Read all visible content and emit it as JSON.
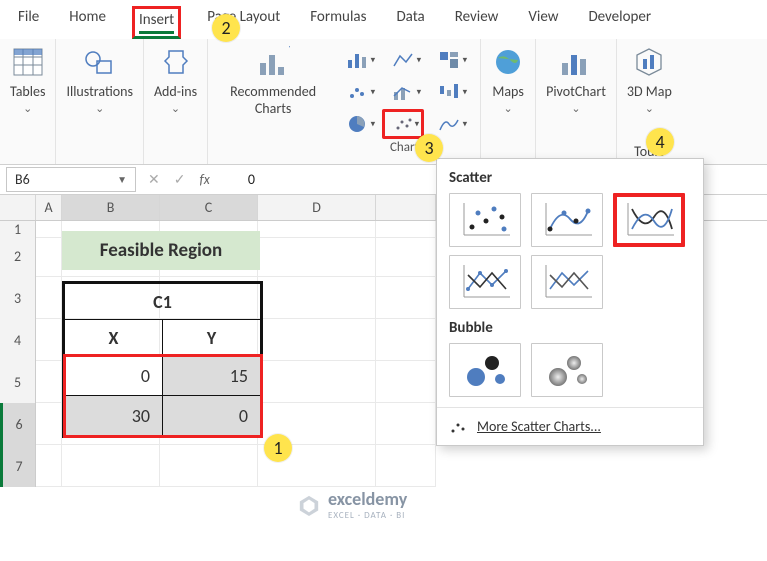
{
  "tabs": [
    "File",
    "Home",
    "Insert",
    "Page Layout",
    "Formulas",
    "Data",
    "Review",
    "View",
    "Developer"
  ],
  "active_tab": "Insert",
  "ribbon": {
    "tables": "Tables",
    "illustrations": "Illustrations",
    "addins": "Add-ins",
    "recommended": "Recommended Charts",
    "charts_group": "Charts",
    "maps": "Maps",
    "pivotchart": "PivotChart",
    "map3d": "3D Map",
    "tours": "Tours"
  },
  "formula_bar": {
    "name_box": "B6",
    "fx_label": "fx",
    "value": "0"
  },
  "columns": [
    "",
    "A",
    "B",
    "C",
    "D",
    ""
  ],
  "row_headers": [
    "1",
    "2",
    "3",
    "4",
    "5",
    "6",
    "7"
  ],
  "worksheet": {
    "title": "Feasible Region",
    "table_header": "C1",
    "col_x": "X",
    "col_y": "Y",
    "row1_x": "0",
    "row1_y": "15",
    "row2_x": "30",
    "row2_y": "0"
  },
  "dropdown": {
    "scatter_label": "Scatter",
    "bubble_label": "Bubble",
    "more_label": "More Scatter Charts..."
  },
  "steps": {
    "s1": "1",
    "s2": "2",
    "s3": "3",
    "s4": "4"
  },
  "watermark": {
    "brand": "exceldemy",
    "tag": "EXCEL · DATA · BI"
  },
  "chart_data": {
    "type": "table",
    "title": "Feasible Region",
    "series_name": "C1",
    "columns": [
      "X",
      "Y"
    ],
    "rows": [
      [
        0,
        15
      ],
      [
        30,
        0
      ]
    ]
  }
}
